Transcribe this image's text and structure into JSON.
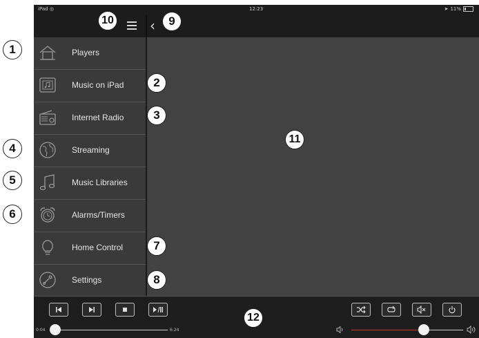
{
  "status_bar": {
    "device": "iPad",
    "time": "12:23",
    "battery": "11%"
  },
  "nav": {
    "back_glyph": "‹"
  },
  "sidebar": {
    "items": [
      {
        "label": "Players",
        "icon": "house-icon"
      },
      {
        "label": "Music on iPad",
        "icon": "ipad-music-icon"
      },
      {
        "label": "Internet Radio",
        "icon": "radio-icon"
      },
      {
        "label": "Streaming",
        "icon": "globe-icon"
      },
      {
        "label": "Music Libraries",
        "icon": "music-note-icon"
      },
      {
        "label": "Alarms/Timers",
        "icon": "alarm-clock-icon"
      },
      {
        "label": "Home Control",
        "icon": "light-bulb-icon"
      },
      {
        "label": "Settings",
        "icon": "wrench-icon"
      }
    ]
  },
  "player": {
    "elapsed": "0:04",
    "duration": "6:24",
    "progress_fraction": 0.02,
    "volume_fraction": 0.65,
    "accent_color": "#c0392b"
  },
  "callouts": {
    "c1": "1",
    "c2": "2",
    "c3": "3",
    "c4": "4",
    "c5": "5",
    "c6": "6",
    "c7": "7",
    "c8": "8",
    "c9": "9",
    "c10": "10",
    "c11": "11",
    "c12": "12"
  }
}
